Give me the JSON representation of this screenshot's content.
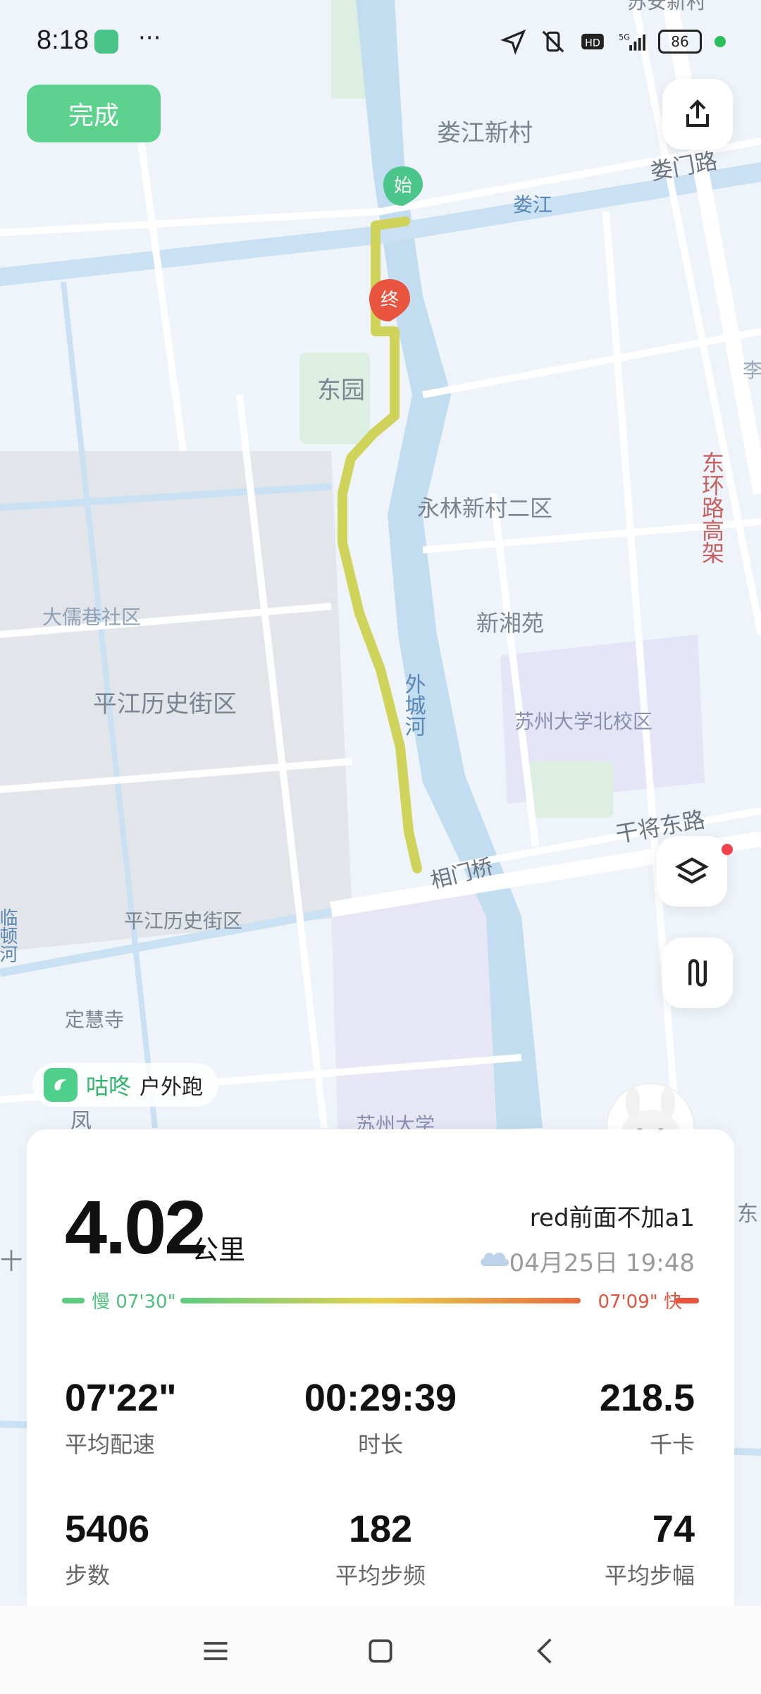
{
  "status_bar": {
    "time": "8:18",
    "dots": "···",
    "battery": "86",
    "icons": [
      "location-arrow-icon",
      "vibrate-off-icon",
      "hd-icon",
      "5g-signal-icon",
      "battery-icon",
      "green-dot-icon"
    ]
  },
  "header": {
    "done_label": "完成",
    "share_icon": "share-icon"
  },
  "map": {
    "start_marker": "始",
    "end_marker": "终",
    "labels": {
      "loujiang_xincun": "娄江新村",
      "loumen_road": "娄门路",
      "loujiang": "娄江",
      "dongyuan": "东园",
      "yonglin": "永林新村二区",
      "donghuan": "东环路高架",
      "daru": "大儒巷社区",
      "xinxiang": "新湘苑",
      "waichenghe": "外城河",
      "pingjiang1": "平江历史街区",
      "suda_north": "苏州大学北校区",
      "ganjiang": "干将东路",
      "xiangmen": "相门桥",
      "pingjiang2": "平江历史街区",
      "dinghui": "定慧寺",
      "suda": "苏州大学",
      "feng": "凤",
      "top_edge": "苏安新村",
      "right_dong": "东",
      "right_li": "李",
      "left_river": "临顿河",
      "left_shi": "十"
    }
  },
  "brand": {
    "name": "咕咚",
    "activity_type": "户外跑"
  },
  "summary": {
    "distance": "4.02",
    "distance_unit": "公里",
    "user_name": "red前面不加a1",
    "date_time": "04月25日 19:48",
    "pace_slow": "慢 07'30\"",
    "pace_fast": "07'09\" 快"
  },
  "stats": {
    "avg_pace": {
      "value": "07'22\"",
      "label": "平均配速"
    },
    "duration": {
      "value": "00:29:39",
      "label": "时长"
    },
    "calories": {
      "value": "218.5",
      "label": "千卡"
    },
    "steps": {
      "value": "5406",
      "label": "步数"
    },
    "cadence": {
      "value": "182",
      "label": "平均步频"
    },
    "stride": {
      "value": "74",
      "label": "平均步幅"
    }
  },
  "colors": {
    "accent_green": "#5dd28e",
    "route": "#cfd35a",
    "end_marker": "#e9543e"
  }
}
